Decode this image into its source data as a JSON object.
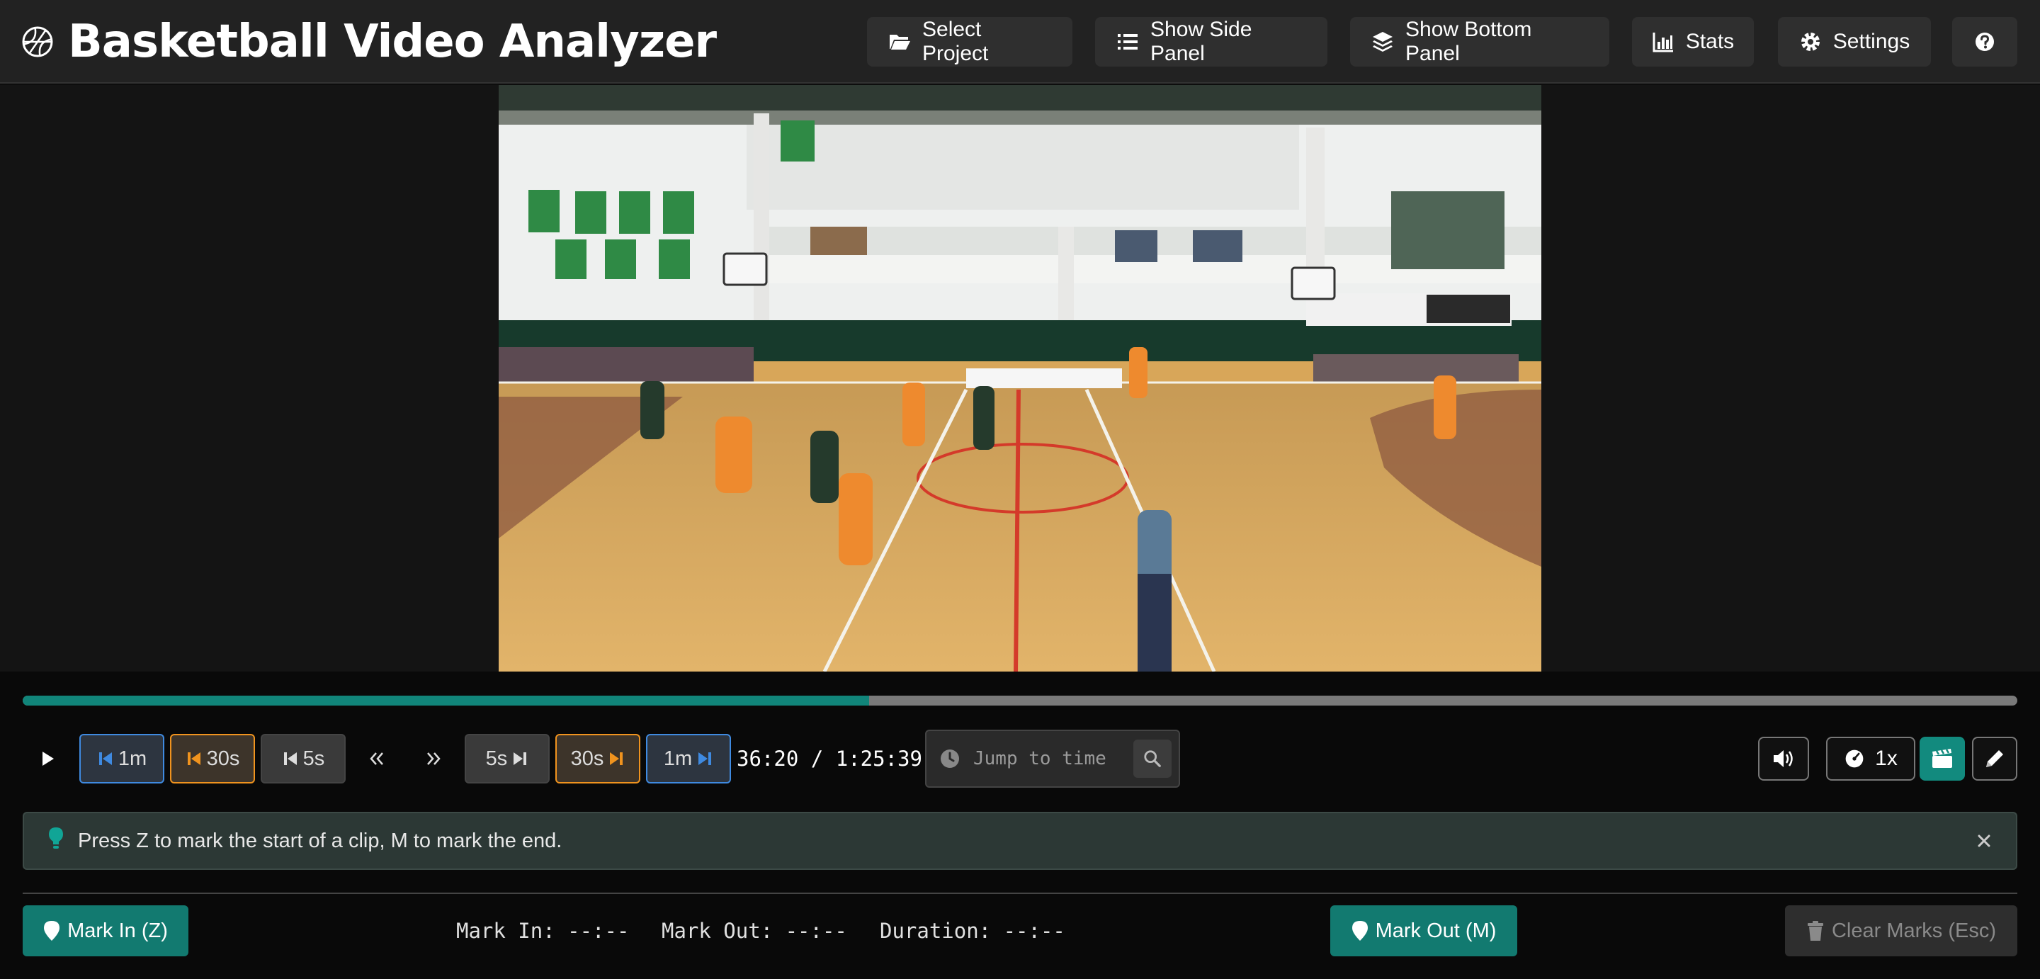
{
  "header": {
    "title": "Basketball Video Analyzer",
    "buttons": {
      "select_project": "Select Project",
      "show_side_panel": "Show Side Panel",
      "show_bottom_panel": "Show Bottom Panel",
      "stats": "Stats",
      "settings": "Settings"
    },
    "icons": [
      "basketball-icon",
      "folder-open-icon",
      "list-icon",
      "layers-icon",
      "bar-chart-icon",
      "gear-icon",
      "question-icon"
    ]
  },
  "player": {
    "progress_fraction": 0.4243,
    "skip_back": {
      "1m": "1m",
      "30s": "30s",
      "5s": "5s"
    },
    "skip_forward": {
      "5s": "5s",
      "30s": "30s",
      "1m": "1m"
    },
    "time_current": "36:20",
    "time_separator": "/",
    "time_total": "1:25:39",
    "jump_placeholder": "Jump to time",
    "speed": "1x",
    "colors": {
      "accent": "#11857a",
      "blue": "#3f8ae0",
      "orange": "#f0931e"
    }
  },
  "tip": {
    "text": "Press Z to mark the start of a clip, M to mark the end."
  },
  "marks": {
    "mark_in_label": "Mark In (Z)",
    "mark_out_label": "Mark Out (M)",
    "mark_in_text": "Mark In: --:--",
    "mark_out_text": "Mark Out: --:--",
    "duration_text": "Duration: --:--",
    "clear_label": "Clear Marks (Esc)"
  }
}
